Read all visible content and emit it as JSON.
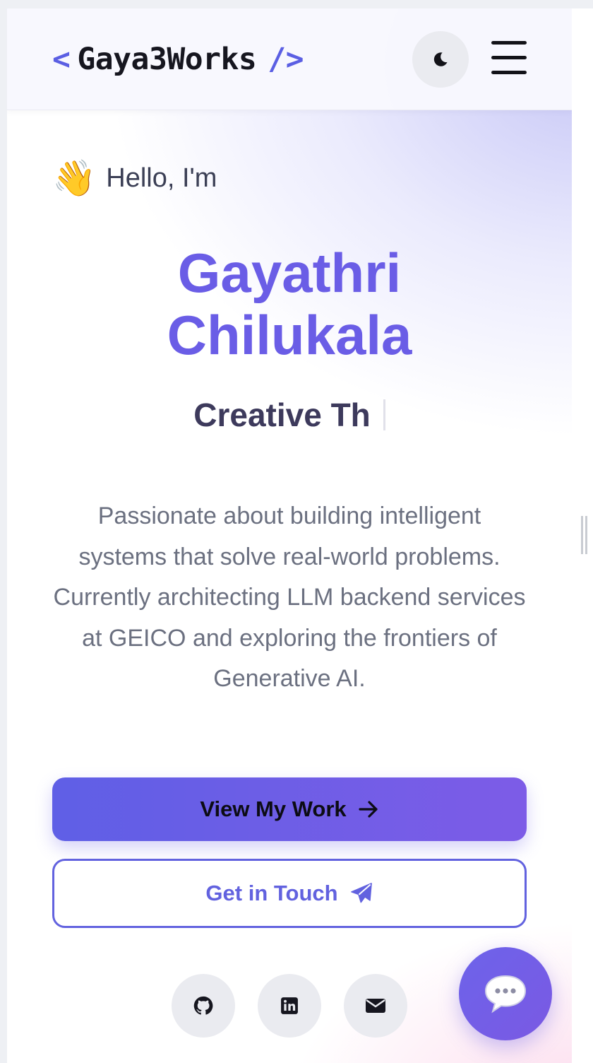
{
  "nav": {
    "logo_open": "<",
    "logo_text": "Gaya3Works",
    "logo_close": "/>",
    "theme_icon": "moon-icon",
    "menu_icon": "hamburger-menu-icon"
  },
  "hero": {
    "wave_emoji": "👋",
    "greeting": "Hello, I'm",
    "name_line1": "Gayathri",
    "name_line2": "Chilukala",
    "role_typed": "Creative Th",
    "bio": "Passionate about building intelligent systems that solve real-world problems. Currently architecting LLM backend services at GEICO and exploring the frontiers of Generative AI.",
    "primary_button": "View My Work",
    "primary_icon": "arrow-right-icon",
    "secondary_button": "Get in Touch",
    "secondary_icon": "paper-plane-icon"
  },
  "social": [
    {
      "icon": "github-icon"
    },
    {
      "icon": "linkedin-icon"
    },
    {
      "icon": "email-icon"
    }
  ],
  "chat": {
    "icon": "chat-bubble-icon"
  },
  "colors": {
    "accent": "#6a5de6",
    "button_gradient_start": "#5f5fe6",
    "button_gradient_end": "#7d5ce7",
    "outline": "#6262df",
    "text_dark": "#16161f",
    "text_muted": "#6b7080"
  }
}
